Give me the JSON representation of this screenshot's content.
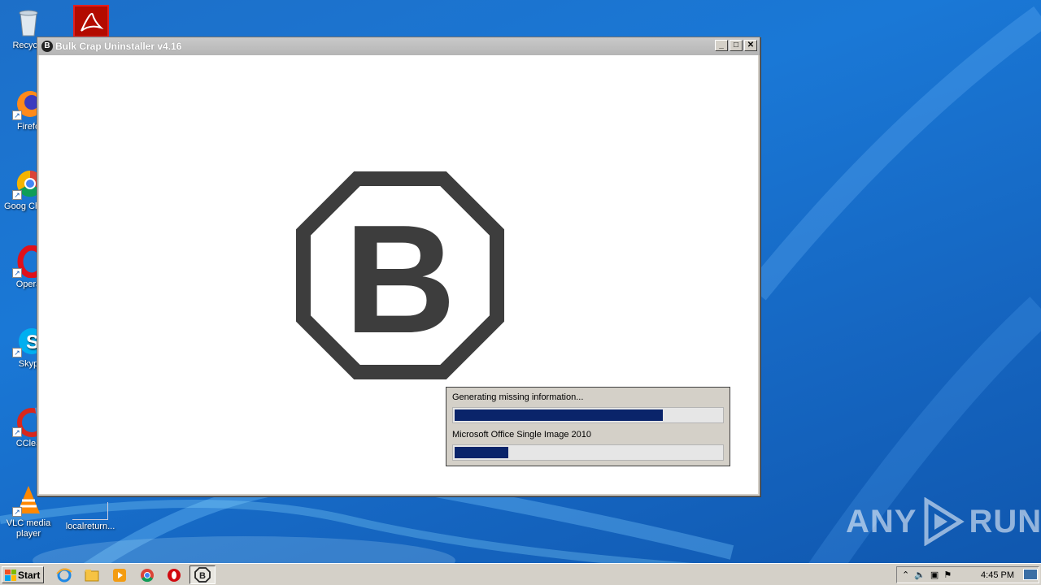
{
  "window": {
    "title": "Bulk Crap Uninstaller v4.16",
    "controls": {
      "minimize": "_",
      "maximize": "□",
      "close": "✕"
    }
  },
  "logo": {
    "letter": "B",
    "color": "#3d3d3d"
  },
  "progress": {
    "primary_label": "Generating missing information...",
    "primary_fraction": 0.78,
    "secondary_label": "Microsoft Office Single Image 2010",
    "secondary_fraction": 0.2
  },
  "desktop_icons": [
    {
      "label": "Recycle",
      "icon": "recycle-bin-icon"
    },
    {
      "label": "Firefo",
      "icon": "firefox-icon"
    },
    {
      "label": "Goog Chron",
      "icon": "chrome-icon"
    },
    {
      "label": "Opera",
      "icon": "opera-icon"
    },
    {
      "label": "Skyp",
      "icon": "skype-icon"
    },
    {
      "label": "CClea",
      "icon": "ccleaner-icon"
    },
    {
      "label": "VLC media player",
      "icon": "vlc-icon"
    },
    {
      "label": "localreturn...",
      "icon": "file-icon"
    }
  ],
  "taskbar": {
    "start_label": "Start",
    "pinned": [
      "ie-icon",
      "explorer-icon",
      "media-player-icon",
      "chrome-icon",
      "opera-icon",
      "bcu-icon"
    ],
    "clock": "4:45 PM"
  },
  "watermark": {
    "text_left": "ANY",
    "text_right": "RUN"
  },
  "colors": {
    "progress_fill": "#0a246a",
    "desktop_blue": "#1a78d6"
  }
}
